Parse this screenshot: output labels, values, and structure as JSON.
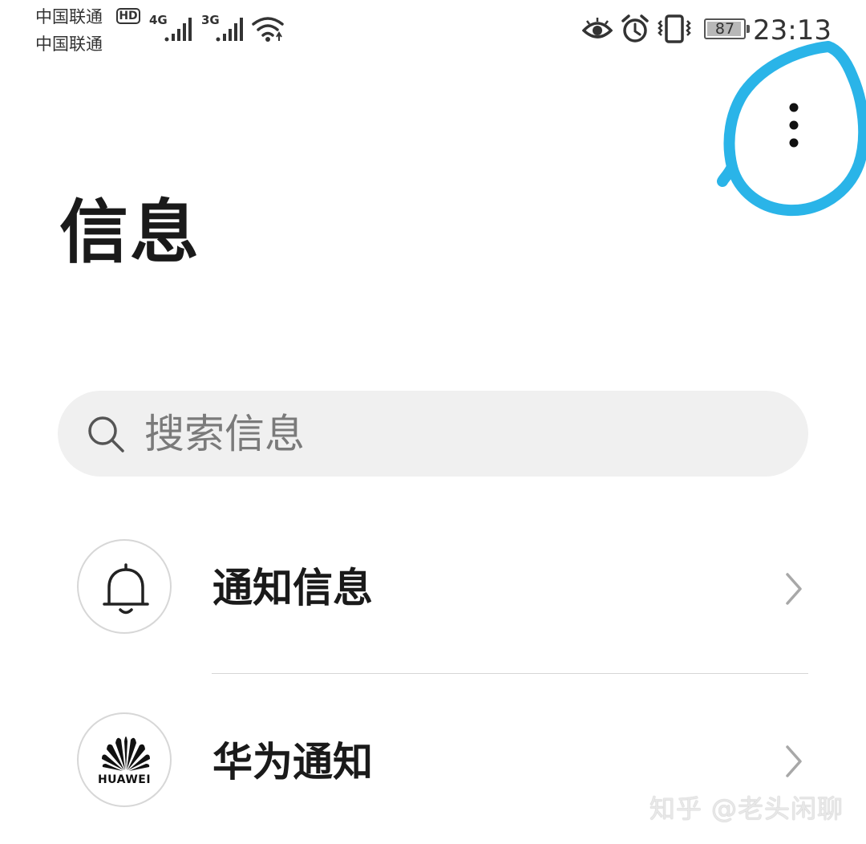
{
  "status_bar": {
    "carrier_1": "中国联通",
    "carrier_2": "中国联通",
    "hd_badge": "HD",
    "network_1": "4G",
    "network_2": "3G",
    "battery_level": "87",
    "time": "23:13",
    "icons": [
      "signal-icon",
      "wifi-icon",
      "eye-icon",
      "alarm-icon",
      "vibrate-icon",
      "battery-icon"
    ]
  },
  "header": {
    "title": "信息",
    "more_menu_icon": "more-vertical-icon",
    "annotation_color": "#2ab4e8"
  },
  "search": {
    "placeholder": "搜索信息",
    "icon": "search-icon"
  },
  "list": {
    "items": [
      {
        "label": "通知信息",
        "icon": "bell-icon"
      },
      {
        "label": "华为通知",
        "icon": "huawei-logo",
        "logo_text": "HUAWEI"
      }
    ]
  },
  "watermark": "知乎 @老头闲聊"
}
